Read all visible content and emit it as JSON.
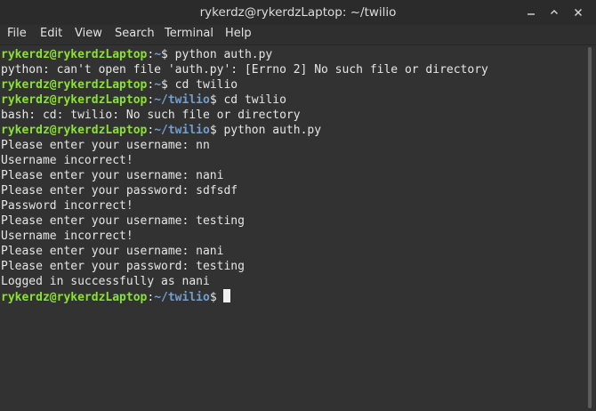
{
  "window": {
    "title": "rykerdz@rykerdzLaptop: ~/twilio"
  },
  "menu": {
    "items": [
      "File",
      "Edit",
      "View",
      "Search",
      "Terminal",
      "Help"
    ]
  },
  "terminal": {
    "lines": [
      {
        "user": "rykerdz@rykerdzLaptop",
        "sep": ":",
        "path": "~",
        "cmd": "$ python auth.py"
      },
      {
        "text": "python: can't open file 'auth.py': [Errno 2] No such file or directory"
      },
      {
        "user": "rykerdz@rykerdzLaptop",
        "sep": ":",
        "path": "~",
        "cmd": "$ cd twilio"
      },
      {
        "user": "rykerdz@rykerdzLaptop",
        "sep": ":",
        "path": "~/twilio",
        "cmd": "$ cd twilio"
      },
      {
        "text": "bash: cd: twilio: No such file or directory"
      },
      {
        "user": "rykerdz@rykerdzLaptop",
        "sep": ":",
        "path": "~/twilio",
        "cmd": "$ python auth.py"
      },
      {
        "text": "Please enter your username: nn"
      },
      {
        "text": "Username incorrect!"
      },
      {
        "text": "Please enter your username: nani"
      },
      {
        "text": "Please enter your password: sdfsdf"
      },
      {
        "text": "Password incorrect!"
      },
      {
        "text": "Please enter your username: testing"
      },
      {
        "text": "Username incorrect!"
      },
      {
        "text": "Please enter your username: nani"
      },
      {
        "text": "Please enter your password: testing"
      },
      {
        "text": "Logged in successfully as nani"
      },
      {
        "user": "rykerdz@rykerdzLaptop",
        "sep": ":",
        "path": "~/twilio",
        "cmd": "$ ",
        "cursor": true
      }
    ]
  },
  "colors": {
    "prompt_user": "#8ae234",
    "prompt_path": "#729fcf",
    "background": "#323232",
    "foreground": "#e6e6e6"
  },
  "icons": {
    "minimize": "minimize-icon",
    "maximize": "maximize-icon",
    "close": "close-icon"
  }
}
